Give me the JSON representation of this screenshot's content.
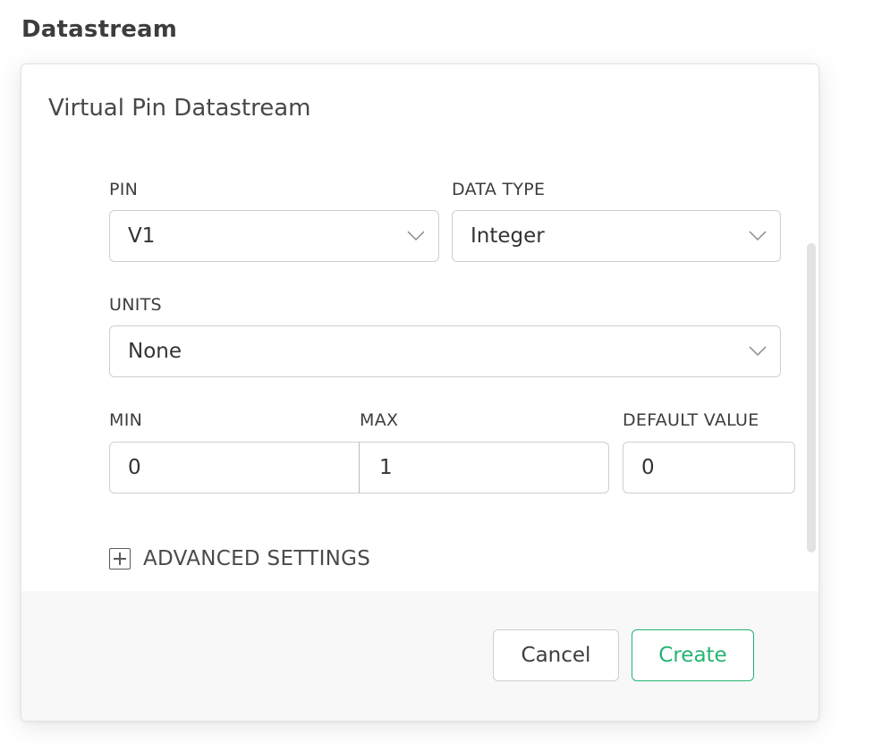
{
  "page": {
    "title": "Datastream"
  },
  "modal": {
    "title": "Virtual Pin Datastream",
    "fields": {
      "pin": {
        "label": "PIN",
        "value": "V1",
        "icon": "chevron-down-icon"
      },
      "data_type": {
        "label": "DATA TYPE",
        "value": "Integer",
        "icon": "chevron-down-icon"
      },
      "units": {
        "label": "UNITS",
        "value": "None",
        "icon": "chevron-down-icon"
      },
      "min": {
        "label": "MIN",
        "value": "0"
      },
      "max": {
        "label": "MAX",
        "value": "1"
      },
      "default_value": {
        "label": "DEFAULT VALUE",
        "value": "0"
      }
    },
    "advanced": {
      "label": "ADVANCED SETTINGS",
      "icon": "plus-square-icon"
    },
    "footer": {
      "cancel_label": "Cancel",
      "create_label": "Create"
    }
  },
  "colors": {
    "accent": "#23b471",
    "border": "#cfcfcf",
    "footer_bg": "#f8f8f8"
  }
}
